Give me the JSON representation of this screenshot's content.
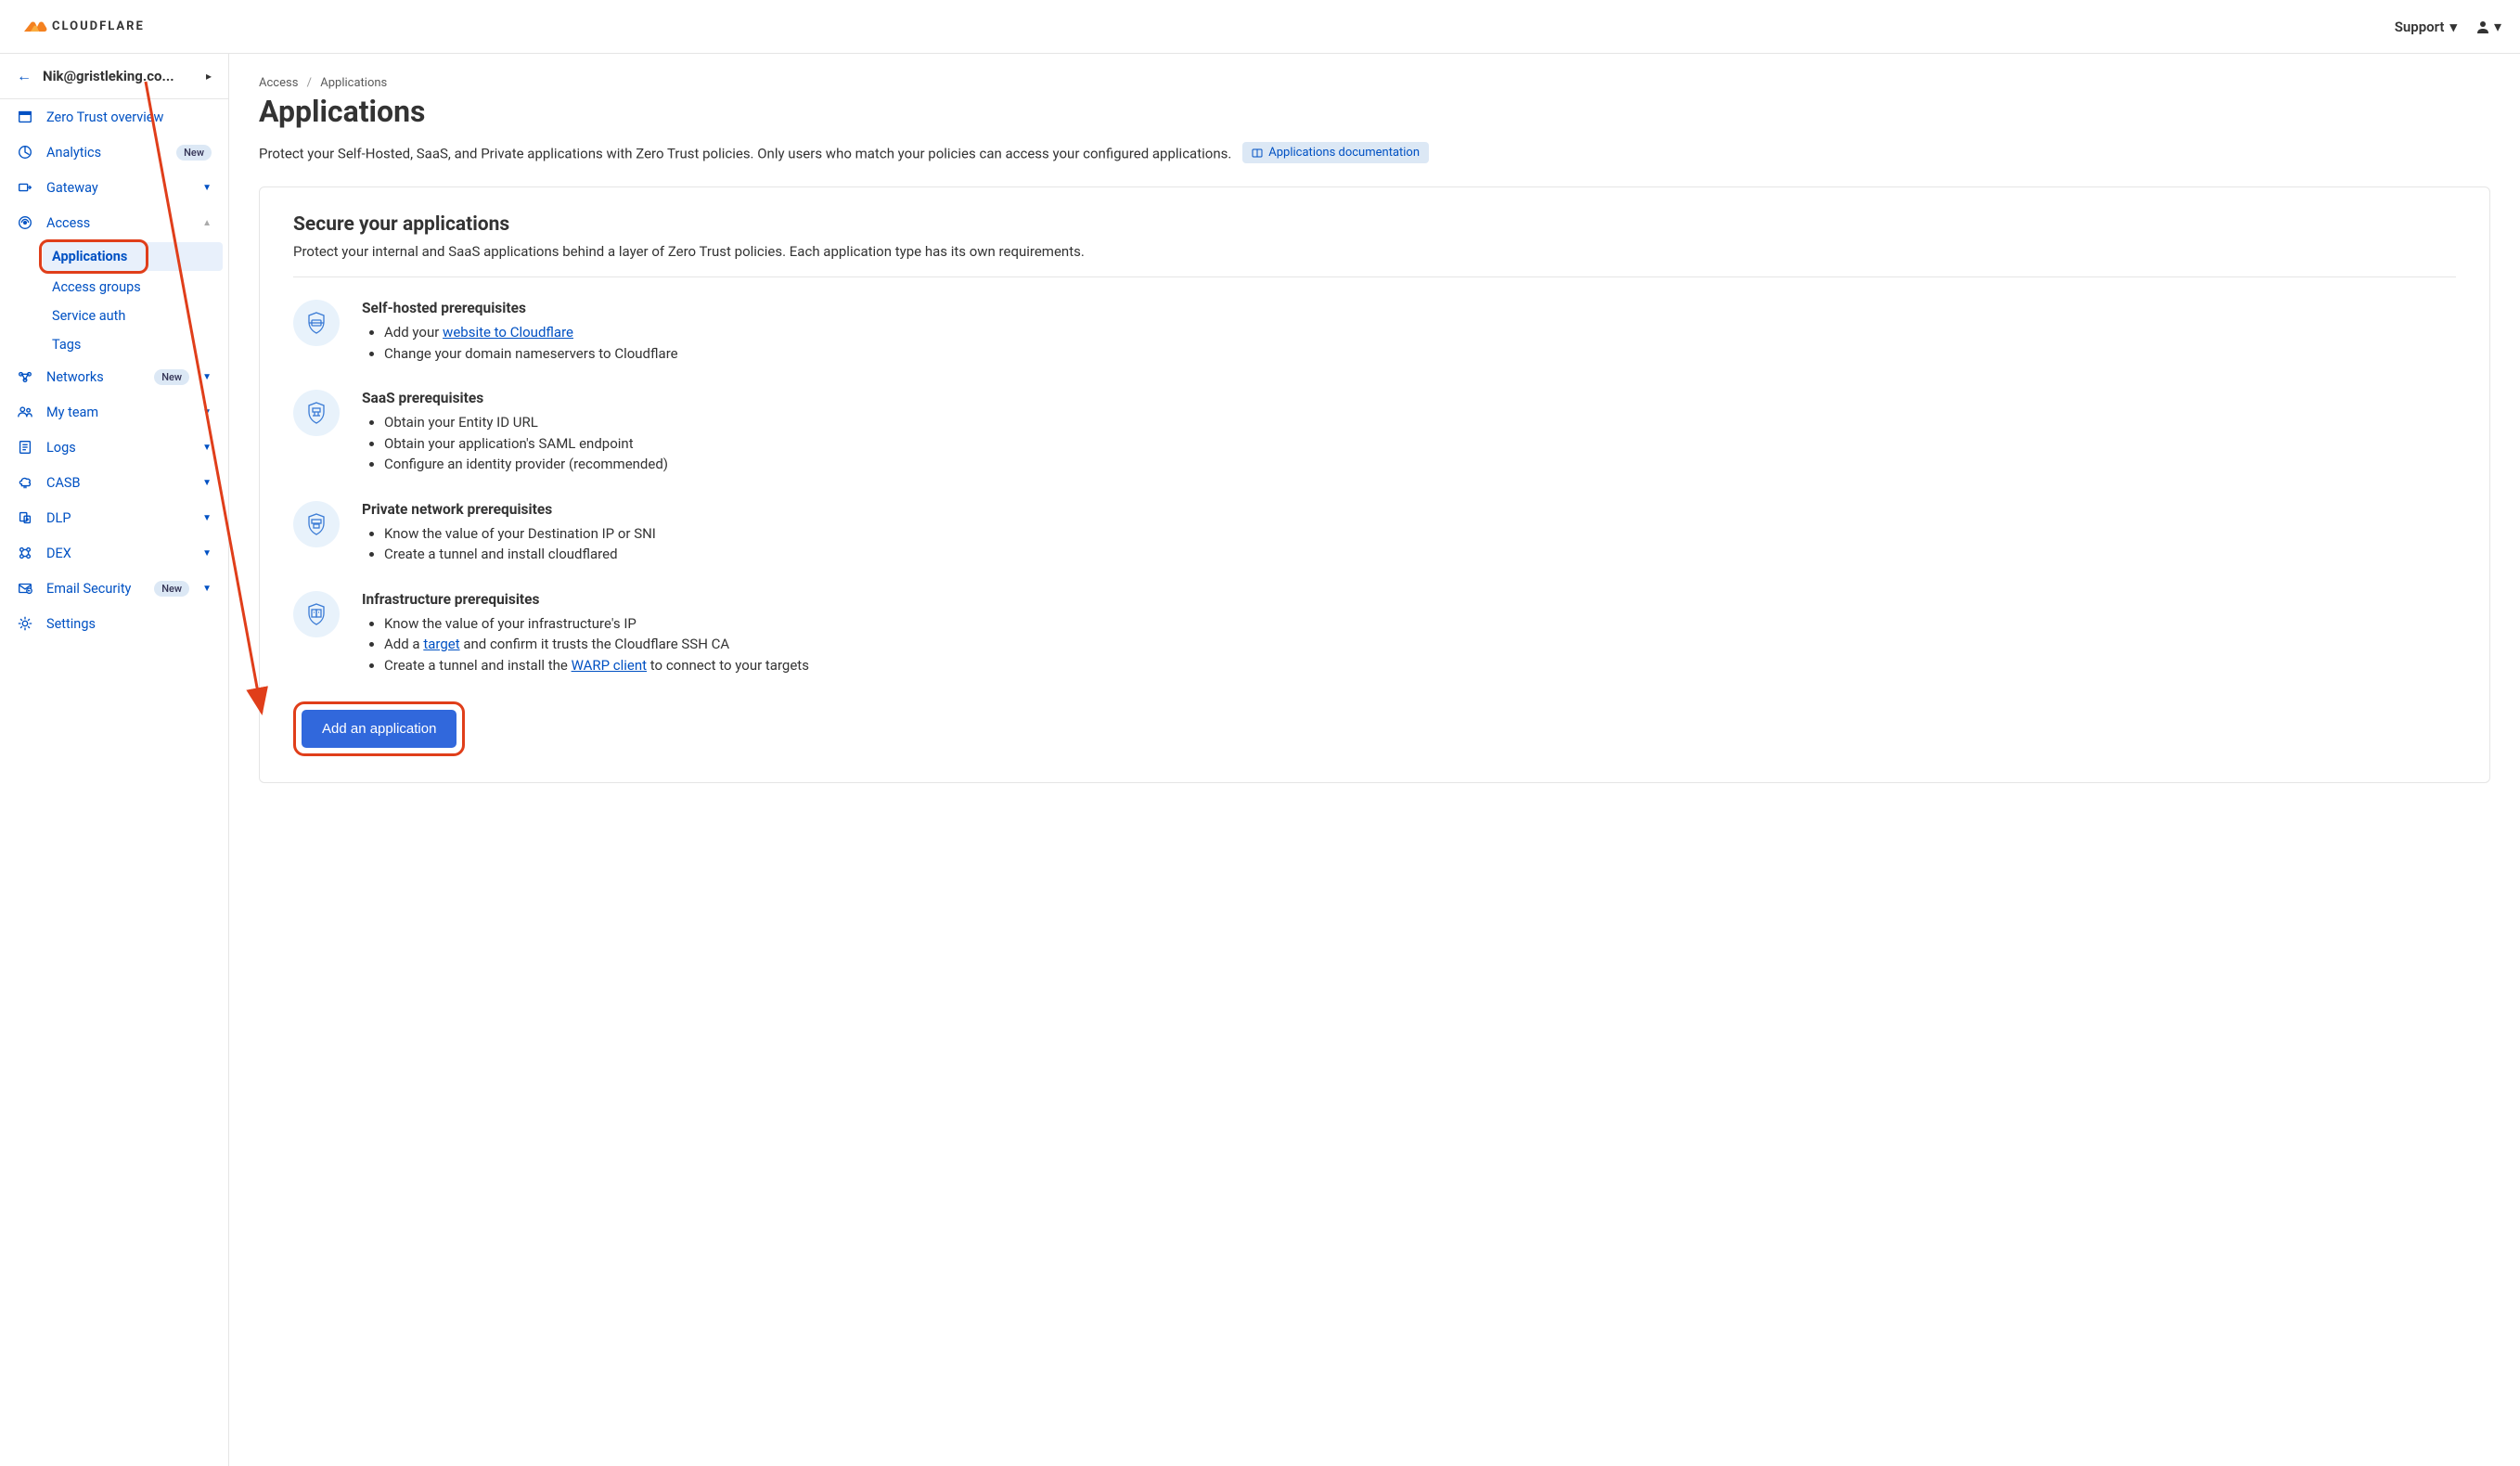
{
  "header": {
    "brand": "CLOUDFLARE",
    "support": "Support"
  },
  "account": {
    "name": "Nik@gristleking.co..."
  },
  "sidebar": {
    "items": [
      {
        "label": "Zero Trust overview",
        "icon": "home"
      },
      {
        "label": "Analytics",
        "icon": "chart",
        "badge": "New"
      },
      {
        "label": "Gateway",
        "icon": "gateway",
        "caret": true
      },
      {
        "label": "Access",
        "icon": "access",
        "caret": true,
        "expanded": true
      },
      {
        "label": "Networks",
        "icon": "networks",
        "badge": "New",
        "caret": true
      },
      {
        "label": "My team",
        "icon": "team",
        "caret": true
      },
      {
        "label": "Logs",
        "icon": "logs",
        "caret": true
      },
      {
        "label": "CASB",
        "icon": "casb",
        "caret": true
      },
      {
        "label": "DLP",
        "icon": "dlp",
        "caret": true
      },
      {
        "label": "DEX",
        "icon": "dex",
        "caret": true
      },
      {
        "label": "Email Security",
        "icon": "email",
        "badge": "New",
        "caret": true
      },
      {
        "label": "Settings",
        "icon": "settings"
      }
    ],
    "accessSubitems": [
      {
        "label": "Applications",
        "active": true
      },
      {
        "label": "Access groups"
      },
      {
        "label": "Service auth"
      },
      {
        "label": "Tags"
      }
    ]
  },
  "breadcrumb": {
    "root": "Access",
    "current": "Applications"
  },
  "page": {
    "title": "Applications",
    "description": "Protect your Self-Hosted, SaaS, and Private applications with Zero Trust policies. Only users who match your policies can access your configured applications.",
    "docBadge": "Applications documentation"
  },
  "card": {
    "title": "Secure your applications",
    "subtitle": "Protect your internal and SaaS applications behind a layer of Zero Trust policies. Each application type has its own requirements.",
    "sections": [
      {
        "title": "Self-hosted prerequisites",
        "items": [
          {
            "prefix": "Add your ",
            "link": "website to Cloudflare"
          },
          {
            "prefix": "Change your domain nameservers to Cloudflare"
          }
        ]
      },
      {
        "title": "SaaS prerequisites",
        "items": [
          {
            "prefix": "Obtain your Entity ID URL"
          },
          {
            "prefix": "Obtain your application's SAML endpoint"
          },
          {
            "prefix": "Configure an identity provider (recommended)"
          }
        ]
      },
      {
        "title": "Private network prerequisites",
        "items": [
          {
            "prefix": "Know the value of your Destination IP or SNI"
          },
          {
            "prefix": "Create a tunnel and install cloudflared"
          }
        ]
      },
      {
        "title": "Infrastructure prerequisites",
        "items": [
          {
            "prefix": "Know the value of your infrastructure's IP"
          },
          {
            "prefix": "Add a ",
            "link": "target",
            "suffix": " and confirm it trusts the Cloudflare SSH CA"
          },
          {
            "prefix": "Create a tunnel and install the ",
            "link": "WARP client",
            "suffix": " to connect to your targets"
          }
        ]
      }
    ],
    "button": "Add an application"
  }
}
